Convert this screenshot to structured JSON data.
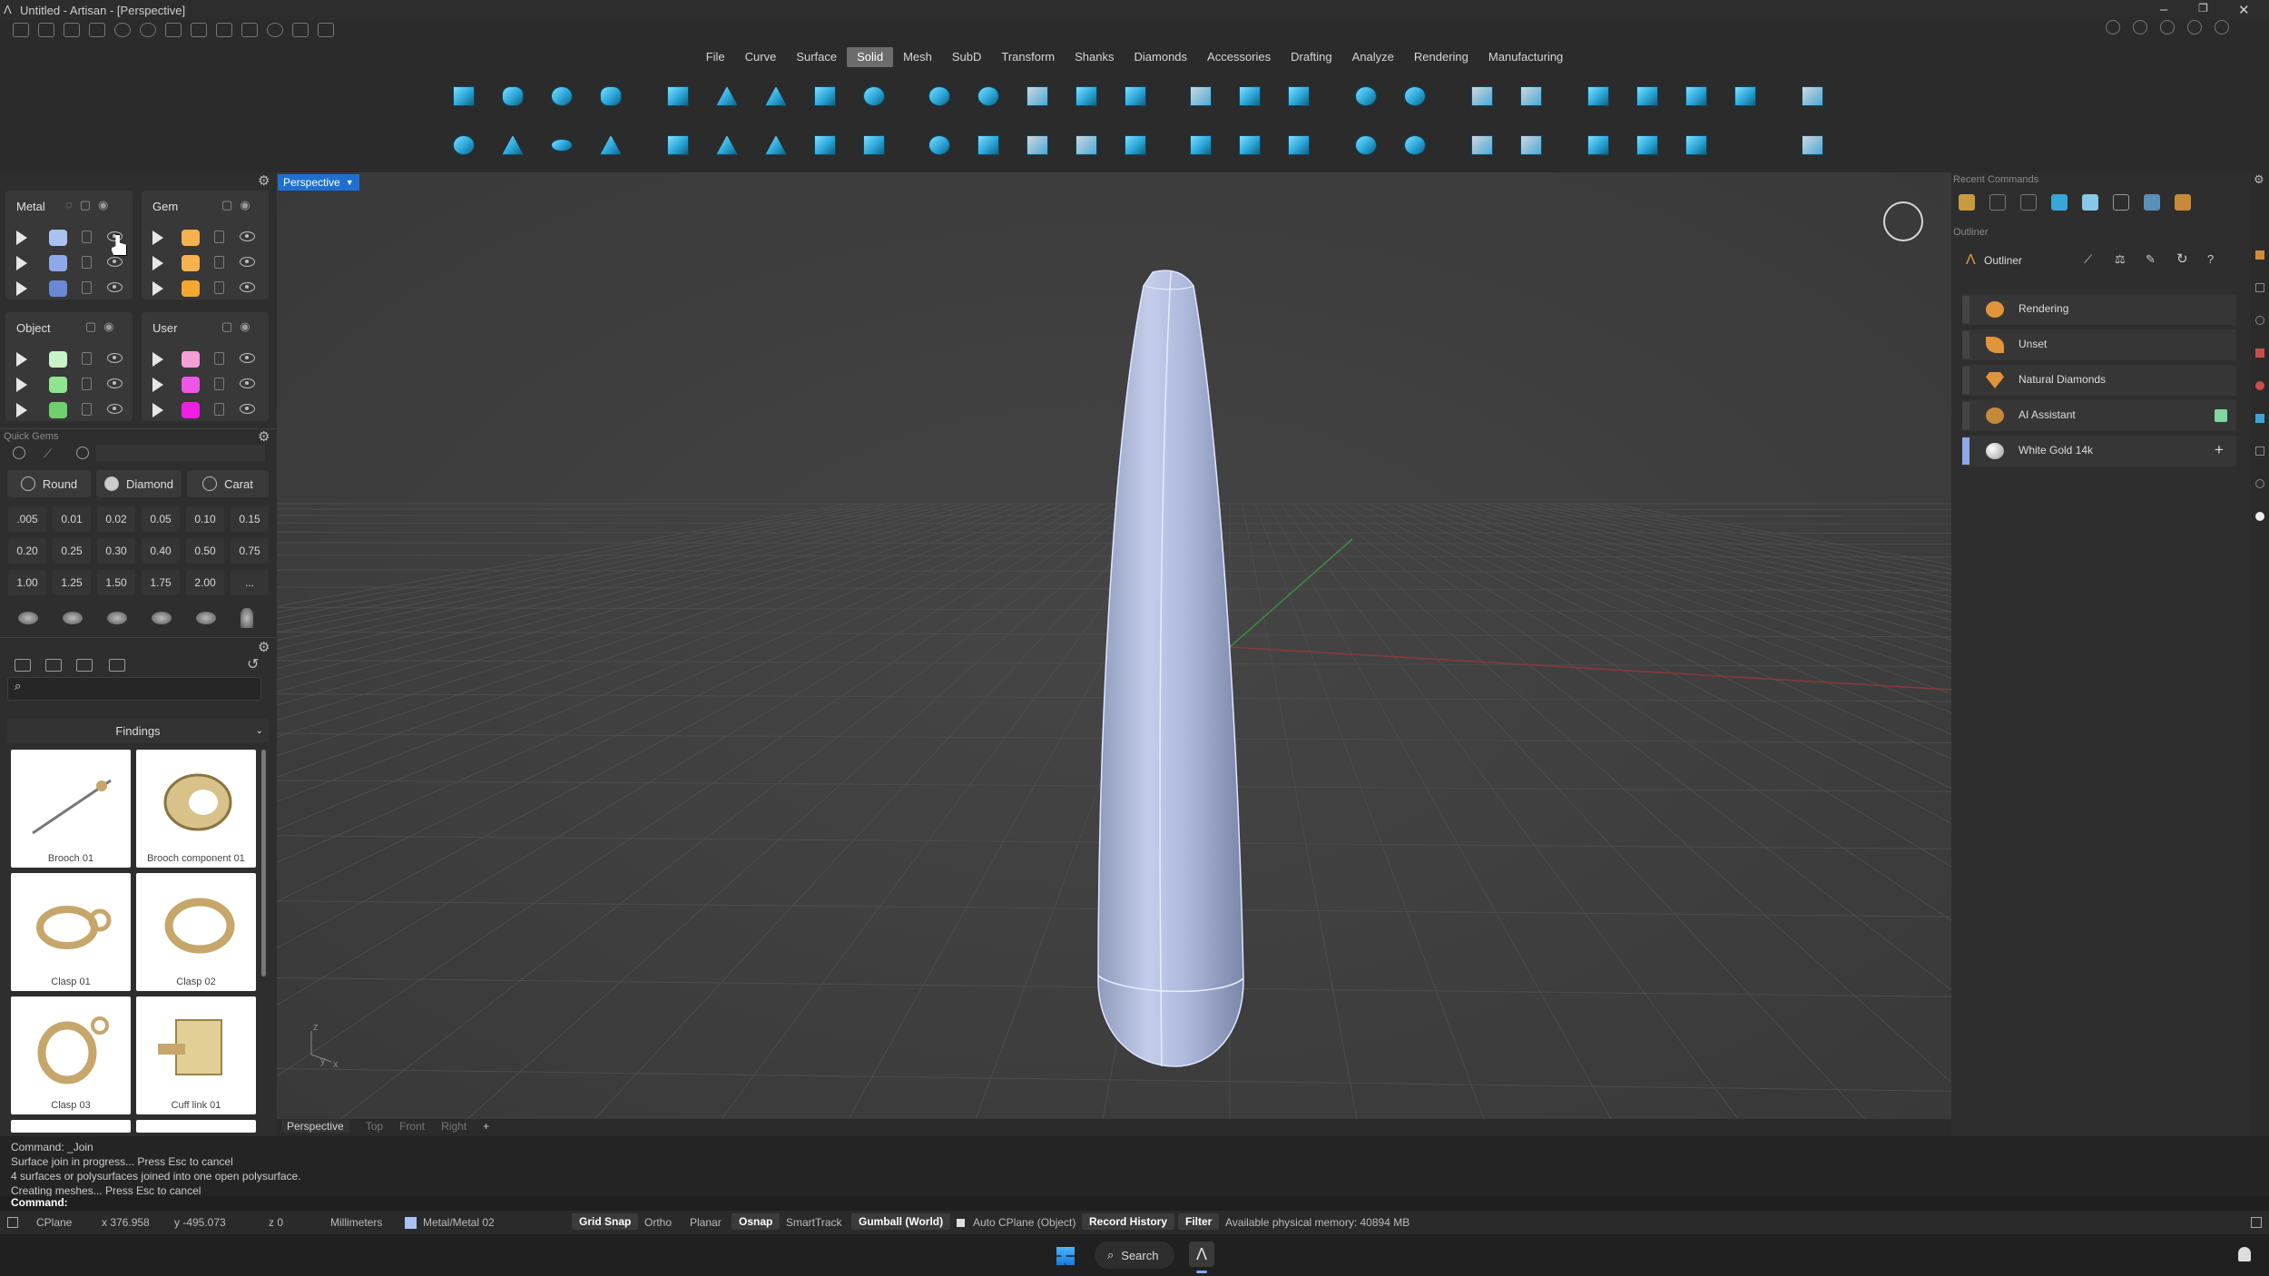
{
  "app": {
    "title": "Untitled - Artisan - [Perspective]"
  },
  "menu": {
    "items": [
      "File",
      "Curve",
      "Surface",
      "Solid",
      "Mesh",
      "SubD",
      "Transform",
      "Shanks",
      "Diamonds",
      "Accessories",
      "Drafting",
      "Analyze",
      "Rendering",
      "Manufacturing"
    ],
    "active": "Solid"
  },
  "layers": {
    "metal": {
      "title": "Metal",
      "colors": [
        "#a9c2f2",
        "#8fa8ea",
        "#6b88d6"
      ]
    },
    "gem": {
      "title": "Gem",
      "colors": [
        "#f5b24f",
        "#f5b24f",
        "#f2a830"
      ]
    },
    "object": {
      "title": "Object",
      "colors": [
        "#c9f3c9",
        "#8fe58f",
        "#6fd06f"
      ]
    },
    "user": {
      "title": "User",
      "colors": [
        "#f2a0d6",
        "#ee56e6",
        "#ee1fe3"
      ]
    }
  },
  "quick_gems": {
    "title": "Quick Gems",
    "shape": "Round",
    "type": "Diamond",
    "unit": "Carat",
    "sizes": [
      ".005",
      "0.01",
      "0.02",
      "0.05",
      "0.10",
      "0.15",
      "0.20",
      "0.25",
      "0.30",
      "0.40",
      "0.50",
      "0.75",
      "1.00",
      "1.25",
      "1.50",
      "1.75",
      "2.00",
      "..."
    ]
  },
  "library": {
    "search_value": "",
    "category": "Findings",
    "items": [
      {
        "label": "Brooch 01"
      },
      {
        "label": "Brooch component 01"
      },
      {
        "label": "Clasp 01"
      },
      {
        "label": "Clasp 02"
      },
      {
        "label": "Clasp 03"
      },
      {
        "label": "Cuff link 01"
      }
    ]
  },
  "viewport": {
    "tab_label": "Perspective",
    "view_tabs": [
      "Perspective",
      "Top",
      "Front",
      "Right"
    ],
    "active_view": "Perspective",
    "add_tab_label": "+",
    "axis_labels": {
      "z": "z",
      "y": "y",
      "x": "x"
    }
  },
  "right_panel": {
    "recent_title": "Recent Commands",
    "outliner_section": "Outliner",
    "outliner_title": "Outliner",
    "rows": [
      {
        "label": "Rendering",
        "icon": "palette-icon"
      },
      {
        "label": "Unset",
        "icon": "leaf-icon"
      },
      {
        "label": "Natural Diamonds",
        "icon": "diamond-icon"
      },
      {
        "label": "AI Assistant",
        "icon": "robot-icon"
      },
      {
        "label": "White Gold 14k",
        "icon": "sphere-icon"
      }
    ]
  },
  "command": {
    "history": [
      "Command: _Join",
      "Surface join in progress... Press Esc to cancel",
      "4 surfaces or polysurfaces joined into one open polysurface.",
      "Creating meshes... Press Esc to cancel"
    ],
    "prompt": "Command:"
  },
  "status": {
    "cplane": "CPlane",
    "x": "x 376.958",
    "y": "y -495.073",
    "z": "z 0",
    "units": "Millimeters",
    "layer": "Metal/Metal 02",
    "grid_snap": "Grid Snap",
    "ortho": "Ortho",
    "planar": "Planar",
    "osnap": "Osnap",
    "smarttrack": "SmartTrack",
    "gumball": "Gumball (World)",
    "auto_cplane": "Auto CPlane (Object)",
    "record_history": "Record History",
    "filter": "Filter",
    "memory": "Available physical memory: 40894 MB"
  },
  "taskbar": {
    "search_label": "Search"
  },
  "colors": {
    "accent": "#1f6fd0",
    "toolbar_icon": "#2aa5d8",
    "model": "#a8b4d6"
  }
}
